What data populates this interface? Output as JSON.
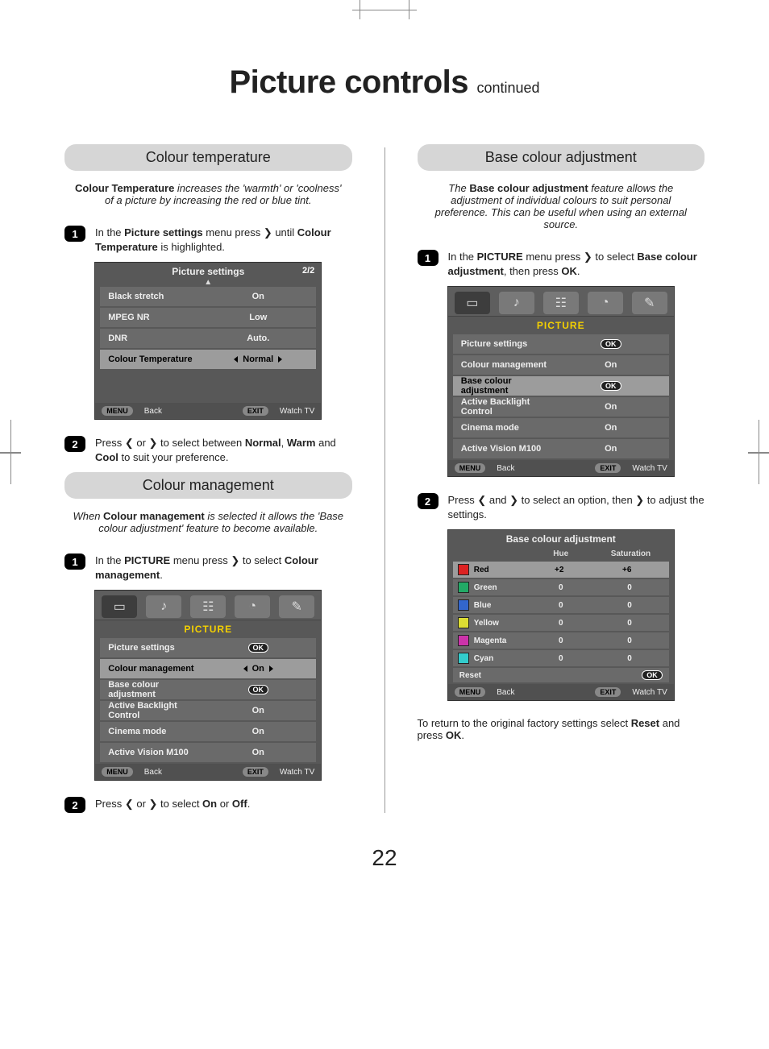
{
  "page": {
    "title_main": "Picture controls",
    "title_sub": "continued",
    "number": "22"
  },
  "colour_temp": {
    "heading": "Colour temperature",
    "intro_html": "<b>Colour Temperature</b> increases the 'warmth' or 'coolness' of a picture by increasing the red or blue tint.",
    "step1_html": "In the <b>Picture settings</b> menu press ❯ until <b>Colour Temperature</b> is highlighted.",
    "step2_html": "Press ❮ or ❯ to select between <b>Normal</b>, <b>Warm</b> and <b>Cool</b> to suit your preference.",
    "osd": {
      "title": "Picture settings",
      "page": "2/2",
      "rows": [
        {
          "label": "Black stretch",
          "value": "On"
        },
        {
          "label": "MPEG NR",
          "value": "Low"
        },
        {
          "label": "DNR",
          "value": "Auto."
        },
        {
          "label": "Colour Temperature",
          "value": "Normal",
          "selected": true,
          "arrows": true
        }
      ],
      "footer_back_btn": "MENU",
      "footer_back": "Back",
      "footer_exit_btn": "EXIT",
      "footer_exit": "Watch TV"
    }
  },
  "colour_mgmt": {
    "heading": "Colour management",
    "intro_html": "When <b>Colour management</b> is selected it allows the 'Base colour adjustment' feature to become available.",
    "step1_html": "In the <b>PICTURE</b> menu press ❯ to select <b>Colour management</b>.",
    "step2_html": "Press ❮ or ❯ to select <b>On</b> or <b>Off</b>.",
    "osd": {
      "cat_title": "PICTURE",
      "rows": [
        {
          "label": "Picture settings",
          "value": "OK",
          "ok": true
        },
        {
          "label": "Colour management",
          "value": "On",
          "selected": true,
          "arrows": true
        },
        {
          "label": "Base colour adjustment",
          "value": "OK",
          "ok": true
        },
        {
          "label": "Active Backlight Control",
          "value": "On"
        },
        {
          "label": "Cinema mode",
          "value": "On"
        },
        {
          "label": "Active Vision M100",
          "value": "On"
        }
      ],
      "footer_back_btn": "MENU",
      "footer_back": "Back",
      "footer_exit_btn": "EXIT",
      "footer_exit": "Watch TV"
    }
  },
  "base_colour": {
    "heading": "Base colour adjustment",
    "intro_html": "The <b>Base colour adjustment</b> feature allows the adjustment of individual colours to suit personal preference. This can be useful when using an external source.",
    "step1_html": "In the <b>PICTURE</b> menu press ❯ to select <b>Base colour adjustment</b>, then press <b>OK</b>.",
    "step2_html": "Press ❮ and ❯ to select an option, then ❯ to adjust the settings.",
    "osd1": {
      "cat_title": "PICTURE",
      "rows": [
        {
          "label": "Picture settings",
          "value": "OK",
          "ok": true
        },
        {
          "label": "Colour management",
          "value": "On"
        },
        {
          "label": "Base colour adjustment",
          "value": "OK",
          "ok": true,
          "selected": true
        },
        {
          "label": "Active Backlight Control",
          "value": "On"
        },
        {
          "label": "Cinema mode",
          "value": "On"
        },
        {
          "label": "Active Vision M100",
          "value": "On"
        }
      ],
      "footer_back_btn": "MENU",
      "footer_back": "Back",
      "footer_exit_btn": "EXIT",
      "footer_exit": "Watch TV"
    },
    "osd2": {
      "title": "Base colour adjustment",
      "col_hue": "Hue",
      "col_sat": "Saturation",
      "rows": [
        {
          "colour": "Red",
          "swatch": "#d22",
          "hue": "+2",
          "sat": "+6",
          "selected": true,
          "arrow": true
        },
        {
          "colour": "Green",
          "swatch": "#2a6",
          "hue": "0",
          "sat": "0"
        },
        {
          "colour": "Blue",
          "swatch": "#36c",
          "hue": "0",
          "sat": "0"
        },
        {
          "colour": "Yellow",
          "swatch": "#dd3",
          "hue": "0",
          "sat": "0"
        },
        {
          "colour": "Magenta",
          "swatch": "#c3a",
          "hue": "0",
          "sat": "0"
        },
        {
          "colour": "Cyan",
          "swatch": "#3cc",
          "hue": "0",
          "sat": "0"
        }
      ],
      "reset_label": "Reset",
      "reset_value": "OK",
      "footer_back_btn": "MENU",
      "footer_back": "Back",
      "footer_exit_btn": "EXIT",
      "footer_exit": "Watch TV"
    },
    "after_text_html": "To return to the original factory settings select <b>Reset</b> and press <b>OK</b>."
  }
}
